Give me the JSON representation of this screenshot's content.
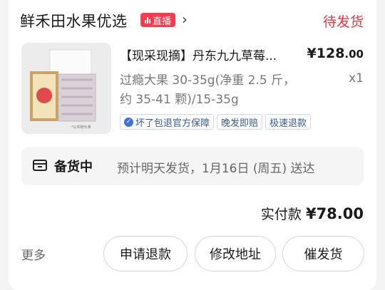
{
  "shop": {
    "name": "鲜禾田水果优选",
    "live_label": "直播",
    "chevron": "›"
  },
  "order_status": "待发货",
  "product": {
    "title": "【现采现摘】丹东九九草莓...",
    "price_symbol": "¥",
    "price_int": "128",
    "price_dec": ".00",
    "spec_line1": "过瘾大果 30-35g(净重 2.5 斤，",
    "spec_line2": "约 35-41 颗)/15-35g",
    "quantity": "x1",
    "tags": [
      "坏了包退官方保障",
      "晚发即赔",
      "极速退款"
    ],
    "image_caption": "*以实物为准"
  },
  "stock": {
    "icon": "package-icon",
    "label": "备货中",
    "description": "预计明天发货，1月16日 (周五) 送达"
  },
  "payment": {
    "label": "实付款",
    "amount": "¥78.00"
  },
  "actions": {
    "more": "更多",
    "refund": "申请退款",
    "change_address": "修改地址",
    "urge": "催发货"
  },
  "colors": {
    "accent_red": "#e8333f",
    "live_badge": "#ff3a4c",
    "tag_blue": "#3b5b92"
  }
}
